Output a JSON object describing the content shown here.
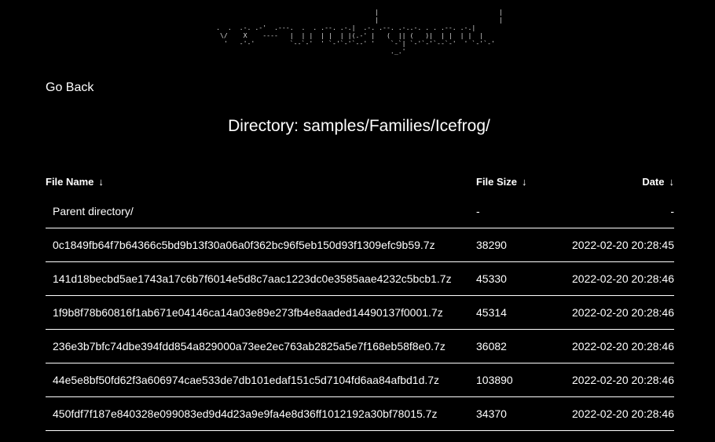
{
  "header": {
    "logo_text": "vx-underground",
    "go_back_label": "Go Back"
  },
  "main": {
    "directory_title": "Directory: samples/Families/Icefrog/"
  },
  "table": {
    "columns": {
      "name": "File Name",
      "size": "File Size",
      "date": "Date",
      "sort_arrow": "↓"
    },
    "parent": {
      "name": "Parent directory/",
      "size": "-",
      "date": "-"
    },
    "rows": [
      {
        "name": "0c1849fb64f7b64366c5bd9b13f30a06a0f362bc96f5eb150d93f1309efc9b59.7z",
        "size": "38290",
        "date": "2022-02-20 20:28:45"
      },
      {
        "name": "141d18becbd5ae1743a17c6b7f6014e5d8c7aac1223dc0e3585aae4232c5bcb1.7z",
        "size": "45330",
        "date": "2022-02-20 20:28:46"
      },
      {
        "name": "1f9b8f78b60816f1ab671e04146ca14a03e89e273fb4e8aaded14490137f0001.7z",
        "size": "45314",
        "date": "2022-02-20 20:28:46"
      },
      {
        "name": "236e3b7bfc74dbe394fdd854a829000a73ee2ec763ab2825a5e7f168eb58f8e0.7z",
        "size": "36082",
        "date": "2022-02-20 20:28:46"
      },
      {
        "name": "44e5e8bf50fd62f3a606974cae533de7db101edaf151c5d7104fd6aa84afbd1d.7z",
        "size": "103890",
        "date": "2022-02-20 20:28:46"
      },
      {
        "name": "450fdf7f187e840328e099083ed9d4d23a9e9fa4e8d36ff1012192a30bf78015.7z",
        "size": "34370",
        "date": "2022-02-20 20:28:46"
      }
    ]
  }
}
